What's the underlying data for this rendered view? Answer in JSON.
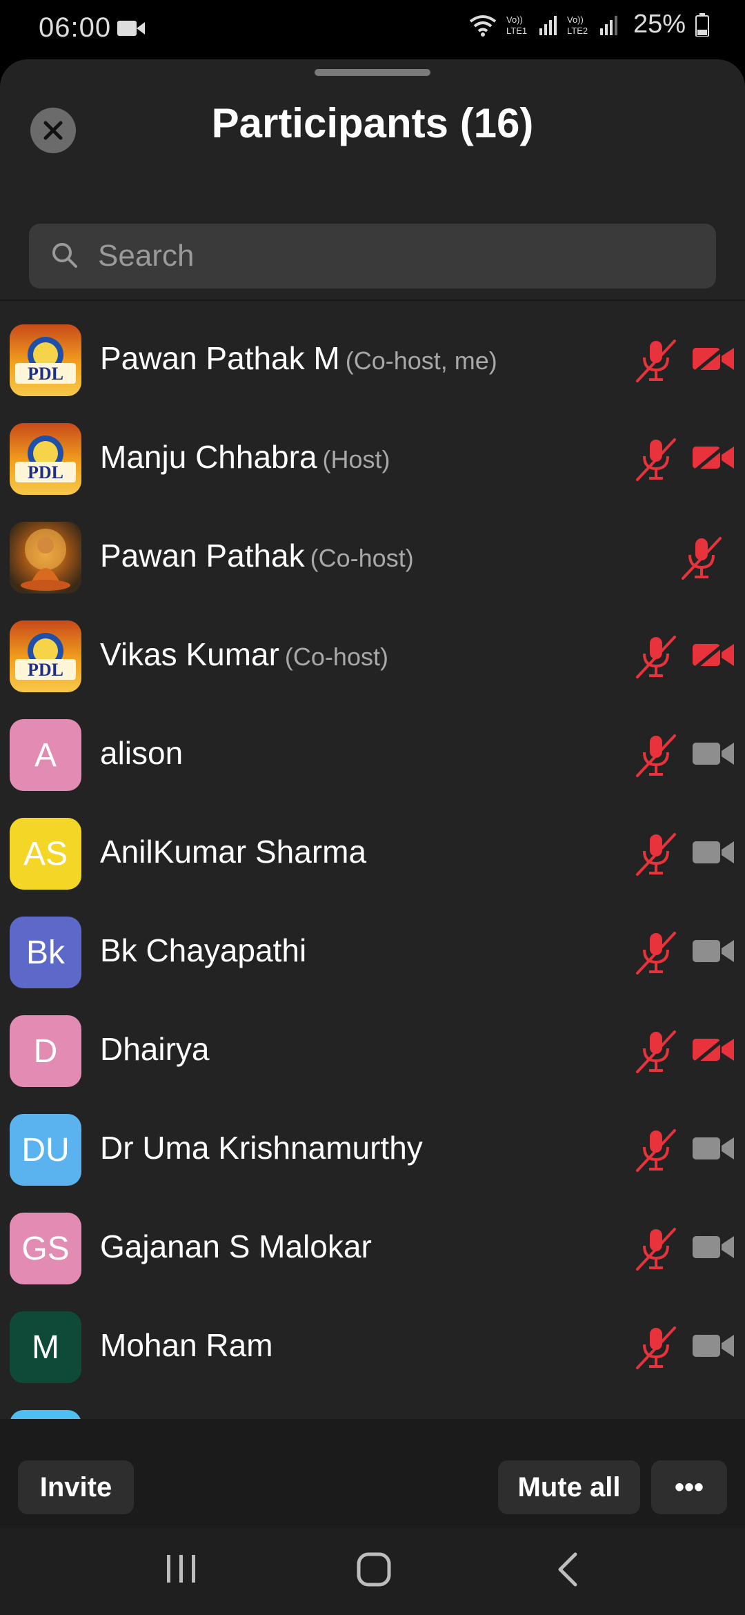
{
  "status_bar": {
    "time": "06:00",
    "battery": "25%",
    "icons": [
      "video-camera-icon",
      "wifi-icon",
      "lte1-signal-icon",
      "lte2-signal-icon",
      "battery-icon"
    ]
  },
  "sheet": {
    "title": "Participants (16)",
    "search_placeholder": "Search"
  },
  "participants": [
    {
      "name": "Pawan Pathak M",
      "role": "(Co-host, me)",
      "avatar": "logo",
      "avatar_text": "PDL",
      "mic": "muted",
      "cam": "off"
    },
    {
      "name": "Manju Chhabra",
      "role": "(Host)",
      "avatar": "logo",
      "avatar_text": "PDL",
      "mic": "muted",
      "cam": "off"
    },
    {
      "name": "Pawan Pathak",
      "role": "(Co-host)",
      "avatar": "photo",
      "avatar_text": "",
      "mic": "muted",
      "cam": "none"
    },
    {
      "name": "Vikas Kumar",
      "role": "(Co-host)",
      "avatar": "logo",
      "avatar_text": "PDL",
      "mic": "muted",
      "cam": "off"
    },
    {
      "name": "alison",
      "role": "",
      "avatar": "letter",
      "avatar_text": "A",
      "color": "#e28bb3",
      "mic": "muted",
      "cam": "on"
    },
    {
      "name": "AnilKumar Sharma",
      "role": "",
      "avatar": "letter",
      "avatar_text": "AS",
      "color": "#f4d626",
      "mic": "muted",
      "cam": "on"
    },
    {
      "name": "Bk Chayapathi",
      "role": "",
      "avatar": "letter",
      "avatar_text": "Bk",
      "color": "#5c69c9",
      "mic": "muted",
      "cam": "on"
    },
    {
      "name": "Dhairya",
      "role": "",
      "avatar": "letter",
      "avatar_text": "D",
      "color": "#e28bb3",
      "mic": "muted",
      "cam": "off"
    },
    {
      "name": "Dr Uma Krishnamurthy",
      "role": "",
      "avatar": "letter",
      "avatar_text": "DU",
      "color": "#5ab3ee",
      "mic": "muted",
      "cam": "on"
    },
    {
      "name": "Gajanan S Malokar",
      "role": "",
      "avatar": "letter",
      "avatar_text": "GS",
      "color": "#e28bb3",
      "mic": "muted",
      "cam": "on"
    },
    {
      "name": "Mohan Ram",
      "role": "",
      "avatar": "letter",
      "avatar_text": "M",
      "color": "#0f4a38",
      "mic": "muted",
      "cam": "on"
    },
    {
      "name": "",
      "role": "",
      "avatar": "letter",
      "avatar_text": "",
      "color": "#4fbff2",
      "mic": "muted",
      "cam": "none"
    }
  ],
  "footer": {
    "invite_label": "Invite",
    "mute_all_label": "Mute all",
    "more_label": "•••"
  },
  "colors": {
    "muted_red": "#e8333c",
    "camera_on_gray": "#8e8e8e",
    "sheet_bg": "#232323"
  }
}
